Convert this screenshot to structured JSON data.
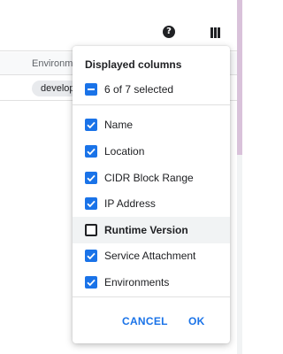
{
  "colors": {
    "accent": "#1a73e8",
    "highlight_bg": "#f1f3f4",
    "chip_bg": "#e8eaed"
  },
  "toolbar": {
    "help_icon": "help-circle-icon",
    "columns_icon": "view-columns-icon",
    "help_glyph": "?"
  },
  "table": {
    "header": "Environment",
    "row_chip": "development"
  },
  "popup": {
    "title": "Displayed columns",
    "summary": "6 of 7 selected",
    "options": [
      {
        "label": "Name",
        "checked": true
      },
      {
        "label": "Location",
        "checked": true
      },
      {
        "label": "CIDR Block Range",
        "checked": true
      },
      {
        "label": "IP Address",
        "checked": true
      },
      {
        "label": "Runtime Version",
        "checked": false
      },
      {
        "label": "Service Attachment",
        "checked": true
      },
      {
        "label": "Environments",
        "checked": true
      }
    ],
    "cancel_label": "CANCEL",
    "ok_label": "OK"
  }
}
